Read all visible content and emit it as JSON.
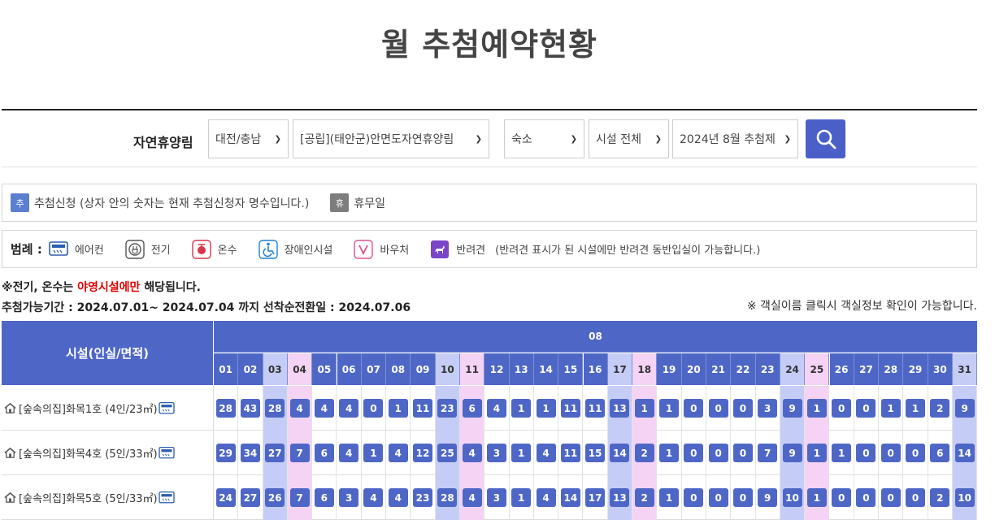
{
  "page": {
    "title": "월 추첨예약현황"
  },
  "search": {
    "label": "자연휴양림",
    "region": "대전/충남",
    "forest": "[공립](태안군)안면도자연휴양림",
    "category": "숙소",
    "facility": "시설 전체",
    "period": "2024년 8월 추첨제"
  },
  "legend1": {
    "apply_icon": "추",
    "apply_text": "추첨신청 (상자 안의 숫자는 현재 추첨신청자 명수입니다.)",
    "closed_icon": "휴",
    "closed_text": "휴무일"
  },
  "legend2": {
    "title": "범례 :",
    "items": [
      {
        "icon": "air-conditioner-icon",
        "label": "에어컨"
      },
      {
        "icon": "electric-plug-icon",
        "label": "전기"
      },
      {
        "icon": "hot-water-icon",
        "label": "온수"
      },
      {
        "icon": "wheelchair-icon",
        "label": "장애인시설"
      },
      {
        "icon": "voucher-icon",
        "label": "바우처"
      },
      {
        "icon": "pet-icon",
        "label": "반려견"
      }
    ],
    "pet_note": "(반려견 표시가 된 시설에만 반려견 동반입실이 가능합니다.)"
  },
  "notices": {
    "line1_pre": "※전기, 온수는 ",
    "line1_red": "야영시설에만",
    "line1_post": " 해당됩니다.",
    "line2": "추첨가능기간 : 2024.07.01~ 2024.07.04 까지 선착순전환일 : 2024.07.06",
    "line3": "※ 객실이름 클릭시 객실정보 확인이 가능합니다."
  },
  "table": {
    "facility_header": "시설(인실/면적)",
    "month": "08",
    "days": [
      "01",
      "02",
      "03",
      "04",
      "05",
      "06",
      "07",
      "08",
      "09",
      "10",
      "11",
      "12",
      "13",
      "14",
      "15",
      "16",
      "17",
      "18",
      "19",
      "20",
      "21",
      "22",
      "23",
      "24",
      "25",
      "26",
      "27",
      "28",
      "29",
      "30",
      "31"
    ],
    "day_types": [
      "w",
      "w",
      "sat",
      "hol",
      "w",
      "w",
      "w",
      "w",
      "w",
      "sat",
      "hol",
      "w",
      "w",
      "w",
      "w",
      "w",
      "sat",
      "hol",
      "w",
      "w",
      "w",
      "w",
      "w",
      "sat",
      "hol",
      "w",
      "w",
      "w",
      "w",
      "w",
      "sat"
    ],
    "rows": [
      {
        "name": "[숲속의집]화목1호 (4인/23㎡)",
        "counts": [
          "28",
          "43",
          "28",
          "4",
          "4",
          "4",
          "0",
          "1",
          "11",
          "23",
          "6",
          "4",
          "1",
          "1",
          "11",
          "11",
          "13",
          "1",
          "1",
          "0",
          "0",
          "0",
          "3",
          "9",
          "1",
          "0",
          "0",
          "1",
          "1",
          "2",
          "9"
        ]
      },
      {
        "name": "[숲속의집]화목4호 (5인/33㎡)",
        "counts": [
          "29",
          "34",
          "27",
          "7",
          "6",
          "4",
          "1",
          "4",
          "12",
          "25",
          "4",
          "3",
          "1",
          "4",
          "11",
          "15",
          "14",
          "2",
          "1",
          "0",
          "0",
          "0",
          "7",
          "9",
          "1",
          "1",
          "0",
          "0",
          "0",
          "6",
          "14"
        ]
      },
      {
        "name": "[숲속의집]화목5호 (5인/33㎡)",
        "counts": [
          "24",
          "27",
          "26",
          "7",
          "6",
          "3",
          "4",
          "4",
          "23",
          "28",
          "4",
          "3",
          "1",
          "4",
          "14",
          "17",
          "13",
          "2",
          "1",
          "0",
          "0",
          "0",
          "9",
          "10",
          "1",
          "0",
          "0",
          "0",
          "0",
          "2",
          "10"
        ]
      }
    ]
  },
  "colors": {
    "primary": "#4e67c6",
    "saturday": "#c5cdf7",
    "holiday": "#f4d3f5",
    "red": "#e20000"
  }
}
